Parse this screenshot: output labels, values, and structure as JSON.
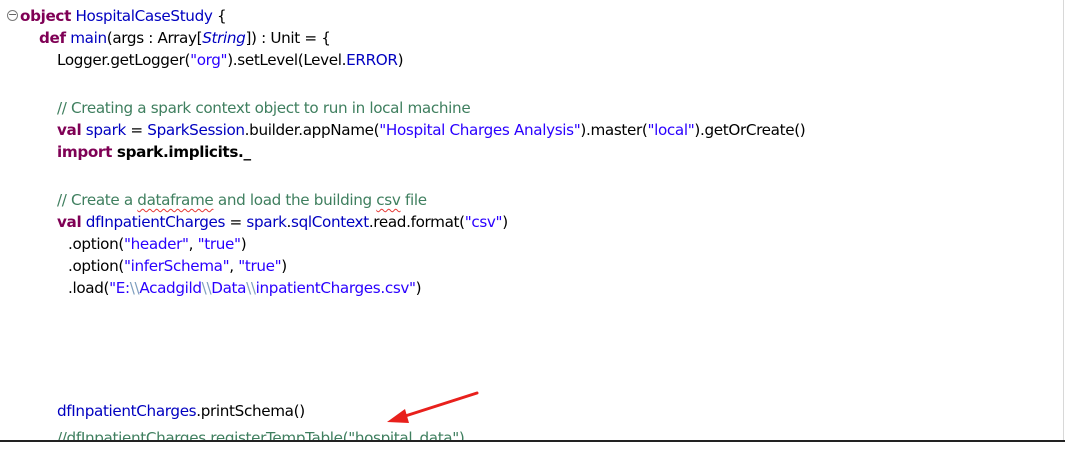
{
  "code": {
    "line1": {
      "kw": "object",
      "name": "HospitalCaseStudy",
      "rest": " {"
    },
    "line2": {
      "kw": "def",
      "sp": " ",
      "fn": "main",
      "a": "(args : Array[",
      "type": "String",
      "b": "]) : Unit = {"
    },
    "line3": {
      "a": "Logger.getLogger(",
      "str1": "\"org\"",
      "b": ").setLevel(Level.",
      "const": "ERROR",
      "c": ")"
    },
    "line4": {
      "comment": "// Creating a spark context object to run in local machine"
    },
    "line5": {
      "kw": "val",
      "var": "spark",
      "eq": " = ",
      "cls": "SparkSession",
      "a": ".builder.appName(",
      "str1": "\"Hospital Charges Analysis\"",
      "b": ").master(",
      "str2": "\"local\"",
      "c": ").getOrCreate()"
    },
    "line6": {
      "kw": "import",
      "rest": " spark.implicits._"
    },
    "line7": {
      "c1": "// Create a ",
      "c2": "dataframe",
      "c3": " and load the building ",
      "c4": "csv",
      "c5": " file"
    },
    "line8": {
      "kw": "val",
      "var": "dfInpatientCharges",
      "eq": " = ",
      "v2": "spark",
      "dot": ".",
      "f": "sqlContext",
      "a": ".read.format(",
      "str1": "\"csv\"",
      "b": ")"
    },
    "line9": {
      "a": ".option(",
      "str1": "\"header\"",
      "sep": ", ",
      "str2": "\"true\"",
      "b": ")"
    },
    "line10": {
      "a": ".option(",
      "str1": "\"inferSchema\"",
      "sep": ", ",
      "str2": "\"true\"",
      "b": ")"
    },
    "line11": {
      "a": ".load(",
      "s1": "\"E:",
      "e1": "\\\\",
      "s2": "Acadgild",
      "e2": "\\\\",
      "s3": "Data",
      "e3": "\\\\",
      "s4": "inpatientCharges.csv\"",
      "b": ")"
    },
    "line12": {
      "var": "dfInpatientCharges",
      "rest": ".printSchema()"
    },
    "line13": {
      "comment": "//dfInpatientCharges.registerTempTable(\"hospital_data\")"
    }
  },
  "colors": {
    "keyword": "#7f0055",
    "type": "#0000c0",
    "string": "#2a00ff",
    "comment": "#3f7f5f",
    "arrow": "#e8201c"
  },
  "icons": {
    "fold": "collapse-minus-icon",
    "annotation": "red-arrow-icon"
  }
}
